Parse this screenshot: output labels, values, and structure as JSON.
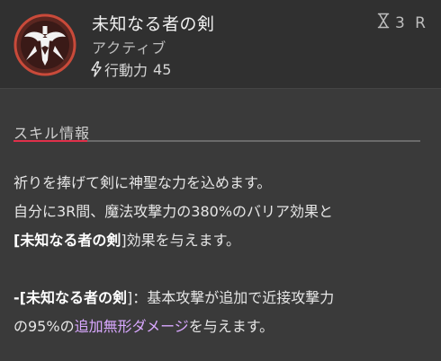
{
  "skill": {
    "name": "未知なる者の剣",
    "type": "アクティブ",
    "cost_label": "行動力",
    "cost_value": "45",
    "cooldown": "3 R",
    "icon": "sword-emblem-icon"
  },
  "section": {
    "title": "スキル情報"
  },
  "description": {
    "line1": "祈りを捧げて剣に神聖な力を込めます。",
    "line2": "自分に3R間、魔法攻撃力の380%のバリア効果と",
    "line3_bracket_open": "[",
    "line3_bold": "未知なる者の剣",
    "line3_rest": "]効果を与えます。",
    "line4_prefix": "-[",
    "line4_bold": "未知なる者の剣",
    "line4_rest": "]：基本攻撃が追加で近接攻撃力",
    "line5_prefix": "の95%の",
    "line5_highlight": "追加無形ダメージ",
    "line5_rest": "を与えます。"
  },
  "colors": {
    "accent_red": "#e0304a",
    "highlight_purple": "#d9a8ff",
    "emblem_ring": "#c94a3a"
  }
}
